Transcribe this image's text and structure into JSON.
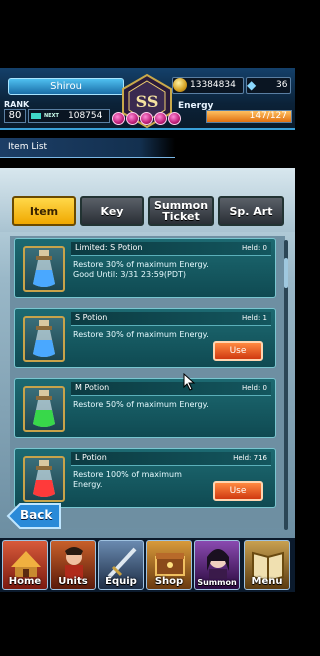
{
  "header": {
    "player_name": "Shirou",
    "gil": "13384834",
    "crystals": "36",
    "rank_label": "RANK",
    "rank": "80",
    "next_label": "NEXT",
    "next_exp": "108754",
    "energy_label": "Energy",
    "energy": "147/127",
    "energy_fill": 1.0,
    "tier_badge": "SS"
  },
  "list_title": "Item List",
  "tabs": [
    {
      "label": "Item",
      "active": true
    },
    {
      "label": "Key",
      "active": false
    },
    {
      "label": "Summon Ticket",
      "active": false
    },
    {
      "label": "Sp. Art",
      "active": false
    }
  ],
  "items": [
    {
      "name": "Limited: S Potion",
      "held": "Held: 0",
      "desc": "Restore 30% of maximum Energy. Good Until: 3/31 23:59(PDT)",
      "color": "#4aa8ff",
      "has_use": false
    },
    {
      "name": "S Potion",
      "held": "Held: 1",
      "desc": "Restore 30% of maximum Energy.",
      "color": "#4aa8ff",
      "has_use": true
    },
    {
      "name": "M Potion",
      "held": "Held: 0",
      "desc": "Restore 50% of maximum Energy.",
      "color": "#38d84a",
      "has_use": false
    },
    {
      "name": "L Potion",
      "held": "Held: 716",
      "desc": "Restore 100% of maximum Energy.",
      "color": "#ff3a3a",
      "has_use": true
    }
  ],
  "use_label": "Use",
  "back_label": "Back",
  "nav": [
    {
      "label": "Home",
      "icon": "home-icon",
      "color": "#b03a2a"
    },
    {
      "label": "Units",
      "icon": "units-icon",
      "color": "#8a3a1a"
    },
    {
      "label": "Equip",
      "icon": "equip-icon",
      "color": "#3a5a7a"
    },
    {
      "label": "Shop",
      "icon": "shop-icon",
      "color": "#a86a1a"
    },
    {
      "label": "Summon",
      "icon": "summon-icon",
      "color": "#6a2a8a"
    },
    {
      "label": "Menu",
      "icon": "menu-icon",
      "color": "#8a6a2a"
    }
  ]
}
